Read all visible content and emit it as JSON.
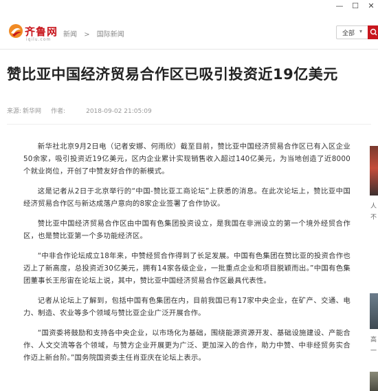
{
  "window": {
    "minimize": "—",
    "maximize": "☐",
    "close": "✕"
  },
  "header": {
    "logo_text": "齐鲁网",
    "logo_sub": "iqilu.com",
    "breadcrumb": [
      "新闻",
      "国际新闻"
    ],
    "breadcrumb_sep": ">",
    "search_scope": "全部",
    "search_caret": "▾"
  },
  "article": {
    "title": "赞比亚中国经济贸易合作区已吸引投资近19亿美元",
    "source_label": "来源:",
    "source": "新华网",
    "author_label": "作者:",
    "date": "2018-09-02 21:05:09",
    "paragraphs": [
      "新华社北京9月2日电（记者安娜、何雨欣）截至目前，赞比亚中国经济贸易合作区已有入区企业50余家，吸引投资近19亿美元，区内企业累计实现销售收入超过140亿美元，为当地创造了近8000个就业岗位，开创了中赞友好合作的新模式。",
      "这是记者从2日于北京举行的“中国-赞比亚工商论坛”上获悉的消息。在此次论坛上，赞比亚中国经济贸易合作区与新达成落户意向的8家企业签署了合作协议。",
      "赞比亚中国经济贸易合作区由中国有色集团投资设立，是我国在非洲设立的第一个境外经贸合作区，也是赞比亚第一个多功能经济区。",
      "“中非合作论坛成立18年来，中赞经贸合作得到了长足发展。中国有色集团在赞比亚的投资合作也迈上了新高度，总投资近30亿美元，拥有14家各级企业，一批重点企业和项目脱颖而出。”中国有色集团董事长王彤宙在论坛上说，其中，赞比亚中国经济贸易合作区最具代表性。",
      "记者从论坛上了解到，包括中国有色集团在内，目前我国已有17家中央企业，在矿产、交通、电力、制造、农业等多个领域与赞比亚企业广泛开展合作。",
      "“国资委将鼓励和支持各中央企业，以市场化为基础，围绕能源资源开发、基础设施建设、产能合作、人文交流等各个领域，与赞方企业开展更为广泛、更加深入的合作，助力中赞、中非经贸务实合作迈上新台阶。”国务院国资委主任肖亚庆在论坛上表示。"
    ]
  },
  "rail": {
    "text1": "人",
    "text2": "不",
    "text3": "高",
    "text4": "一"
  },
  "colors": {
    "brand": "#c8161d",
    "title": "#222222",
    "body": "#333333",
    "meta": "#999999"
  }
}
